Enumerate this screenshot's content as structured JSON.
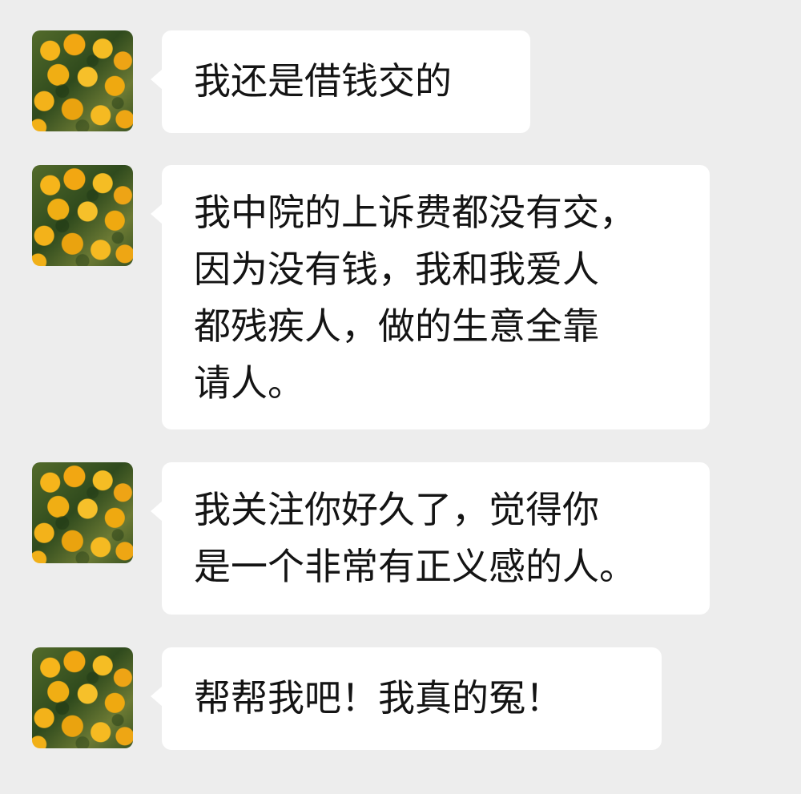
{
  "messages": [
    {
      "text": "我还是借钱交的"
    },
    {
      "text": "我中院的上诉费都没有交，\n因为没有钱，我和我爱人\n都残疾人，做的生意全靠\n请人。"
    },
    {
      "text": "我关注你好久了，觉得你\n是一个非常有正义感的人。"
    },
    {
      "text": "帮帮我吧！我真的冤！"
    }
  ],
  "colors": {
    "background": "#ededed",
    "bubble": "#ffffff",
    "text": "#141414"
  }
}
